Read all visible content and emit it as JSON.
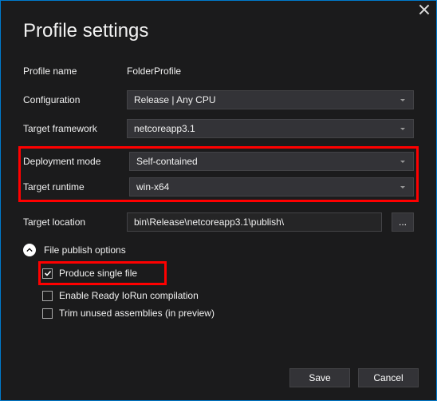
{
  "title": "Profile settings",
  "labels": {
    "profile_name": "Profile name",
    "configuration": "Configuration",
    "target_framework": "Target framework",
    "deployment_mode": "Deployment mode",
    "target_runtime": "Target runtime",
    "target_location": "Target location",
    "file_publish_options": "File publish options",
    "produce_single_file": "Produce single file",
    "enable_ready2run": "Enable Ready IoRun compilation",
    "trim_unused": "Trim unused assemblies (in preview)"
  },
  "values": {
    "profile_name": "FolderProfile",
    "configuration": "Release | Any CPU",
    "target_framework": "netcoreapp3.1",
    "deployment_mode": "Self-contained",
    "target_runtime": "win-x64",
    "target_location": "bin\\Release\\netcoreapp3.1\\publish\\",
    "browse": "..."
  },
  "buttons": {
    "save": "Save",
    "cancel": "Cancel"
  }
}
